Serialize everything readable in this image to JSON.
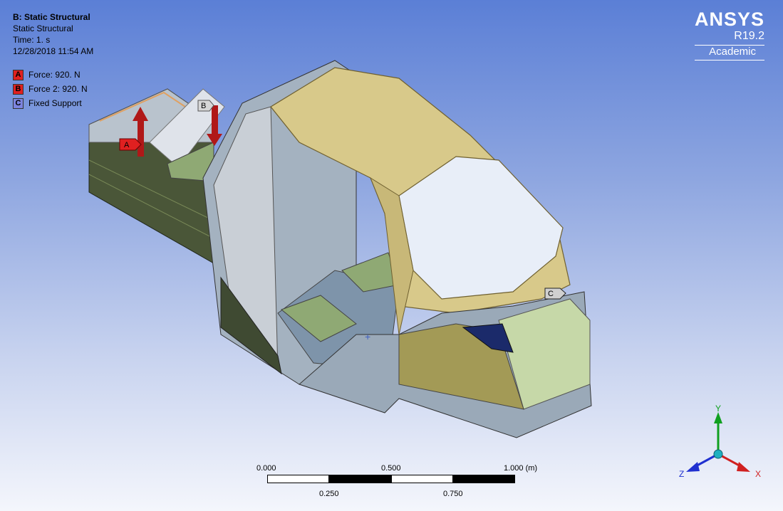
{
  "header": {
    "title": "B: Static Structural",
    "subtitle": "Static Structural",
    "time": "Time: 1. s",
    "date": "12/28/2018 11:54 AM"
  },
  "legend": [
    {
      "letter": "A",
      "label": "Force: 920. N",
      "color": "#e02020"
    },
    {
      "letter": "B",
      "label": "Force 2: 920. N",
      "color": "#e02020"
    },
    {
      "letter": "C",
      "label": "Fixed Support",
      "color": "#7c84e0"
    }
  ],
  "logo": {
    "brand": "ANSYS",
    "version": "R19.2",
    "edition": "Academic"
  },
  "scale": {
    "top_labels": [
      "0.000",
      "0.500",
      "1.000 (m)"
    ],
    "bottom_labels": [
      "0.250",
      "0.750"
    ]
  },
  "axes": {
    "x": "X",
    "y": "Y",
    "z": "Z"
  },
  "model_tags": {
    "a": "A",
    "b": "B",
    "c": "C"
  },
  "colors": {
    "body_gray": "#9aa9b8",
    "body_dark": "#3f4a32",
    "roof_yellow": "#d8c98a",
    "floor_green": "#8fa974",
    "force_red": "#b01818",
    "x_axis": "#d02020",
    "y_axis": "#10a020",
    "z_axis": "#2030d0"
  }
}
